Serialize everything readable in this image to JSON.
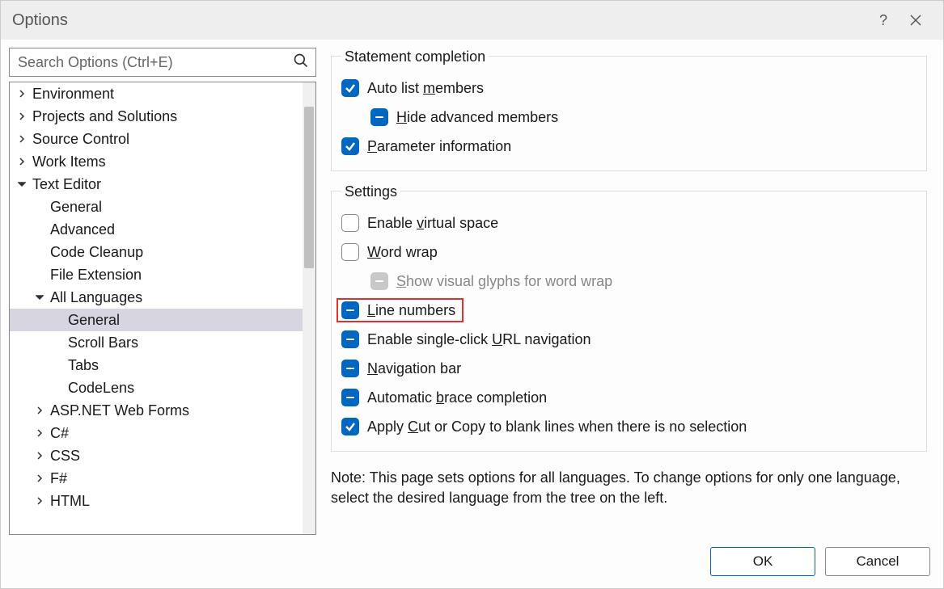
{
  "title": "Options",
  "search": {
    "placeholder": "Search Options (Ctrl+E)"
  },
  "tree": [
    {
      "label": "Environment",
      "indent": 0,
      "arrow": "collapsed"
    },
    {
      "label": "Projects and Solutions",
      "indent": 0,
      "arrow": "collapsed"
    },
    {
      "label": "Source Control",
      "indent": 0,
      "arrow": "collapsed"
    },
    {
      "label": "Work Items",
      "indent": 0,
      "arrow": "collapsed"
    },
    {
      "label": "Text Editor",
      "indent": 0,
      "arrow": "expanded"
    },
    {
      "label": "General",
      "indent": 1,
      "arrow": "none"
    },
    {
      "label": "Advanced",
      "indent": 1,
      "arrow": "none"
    },
    {
      "label": "Code Cleanup",
      "indent": 1,
      "arrow": "none"
    },
    {
      "label": "File Extension",
      "indent": 1,
      "arrow": "none"
    },
    {
      "label": "All Languages",
      "indent": 1,
      "arrow": "expanded"
    },
    {
      "label": "General",
      "indent": 2,
      "arrow": "none",
      "selected": true
    },
    {
      "label": "Scroll Bars",
      "indent": 2,
      "arrow": "none"
    },
    {
      "label": "Tabs",
      "indent": 2,
      "arrow": "none"
    },
    {
      "label": "CodeLens",
      "indent": 2,
      "arrow": "none"
    },
    {
      "label": "ASP.NET Web Forms",
      "indent": 1,
      "arrow": "collapsed"
    },
    {
      "label": "C#",
      "indent": 1,
      "arrow": "collapsed"
    },
    {
      "label": "CSS",
      "indent": 1,
      "arrow": "collapsed"
    },
    {
      "label": "F#",
      "indent": 1,
      "arrow": "collapsed"
    },
    {
      "label": "HTML",
      "indent": 1,
      "arrow": "collapsed"
    }
  ],
  "groups": {
    "statement": {
      "title": "Statement completion",
      "auto_list": {
        "pre": "Auto list ",
        "u": "m",
        "post": "embers",
        "state": "checked"
      },
      "hide_adv": {
        "u": "H",
        "post": "ide advanced members",
        "state": "indet"
      },
      "param_info": {
        "u": "P",
        "post": "arameter information",
        "state": "checked"
      }
    },
    "settings": {
      "title": "Settings",
      "virtual": {
        "pre": "Enable ",
        "u": "v",
        "post": "irtual space",
        "state": "empty"
      },
      "wrap": {
        "u": "W",
        "post": "ord wrap",
        "state": "empty"
      },
      "glyphs": {
        "u": "S",
        "post": "how visual glyphs for word wrap",
        "state": "disabled"
      },
      "linenum": {
        "u": "L",
        "post": "ine numbers",
        "state": "indet",
        "highlight": true
      },
      "urlnav": {
        "pre": "Enable single-click ",
        "u": "U",
        "post": "RL navigation",
        "state": "indet"
      },
      "navbar": {
        "u": "N",
        "post": "avigation bar",
        "state": "indet"
      },
      "brace": {
        "pre": "Automatic ",
        "u": "b",
        "post": "race completion",
        "state": "indet"
      },
      "cutcopy": {
        "pre": "Apply ",
        "u": "C",
        "post": "ut or Copy to blank lines when there is no selection",
        "state": "checked"
      }
    }
  },
  "note": "Note: This page sets options for all languages. To change options for only one language, select the desired language from the tree on the left.",
  "buttons": {
    "ok": "OK",
    "cancel": "Cancel"
  }
}
